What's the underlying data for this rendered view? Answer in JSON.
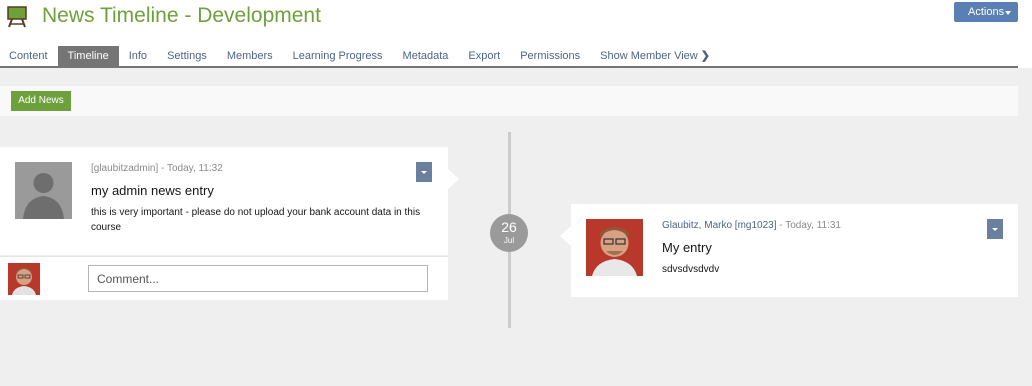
{
  "app": {
    "title": "News Timeline - Development",
    "icon": "easel-icon",
    "accent": "#6ea03c",
    "actions_label": "Actions"
  },
  "tabs": [
    {
      "label": "Content",
      "active": false
    },
    {
      "label": "Timeline",
      "active": true
    },
    {
      "label": "Info",
      "active": false
    },
    {
      "label": "Settings",
      "active": false
    },
    {
      "label": "Members",
      "active": false
    },
    {
      "label": "Learning Progress",
      "active": false
    },
    {
      "label": "Metadata",
      "active": false
    },
    {
      "label": "Export",
      "active": false
    },
    {
      "label": "Permissions",
      "active": false
    },
    {
      "label": "Show Member View",
      "active": false,
      "icon": "chevron-right-icon"
    }
  ],
  "toolbar": {
    "add_news_label": "Add News",
    "button_color": "#6ea03c"
  },
  "timeline": {
    "date_day": "26",
    "date_month": "Jul",
    "entries": [
      {
        "side": "left",
        "author": "[glaubitzadmin]",
        "meta_suffix": " - Today, 11:32",
        "title": "my admin news entry",
        "text": "this is very important - please do not upload your bank account data in this course",
        "avatar": "default-user-avatar"
      },
      {
        "side": "right",
        "author": "Glaubitz, Marko [mg1023]",
        "meta_suffix": " - Today, 11:31",
        "title": "My entry",
        "text": "sdvsdvsdvdv",
        "avatar": "user-photo-avatar"
      }
    ]
  },
  "comment": {
    "placeholder": "Comment..."
  },
  "colors": {
    "tab_active_bg": "#757575",
    "link": "#4c6586",
    "actions_bg": "#5a7fb5",
    "dropdown_bg": "#6b7f9e"
  }
}
